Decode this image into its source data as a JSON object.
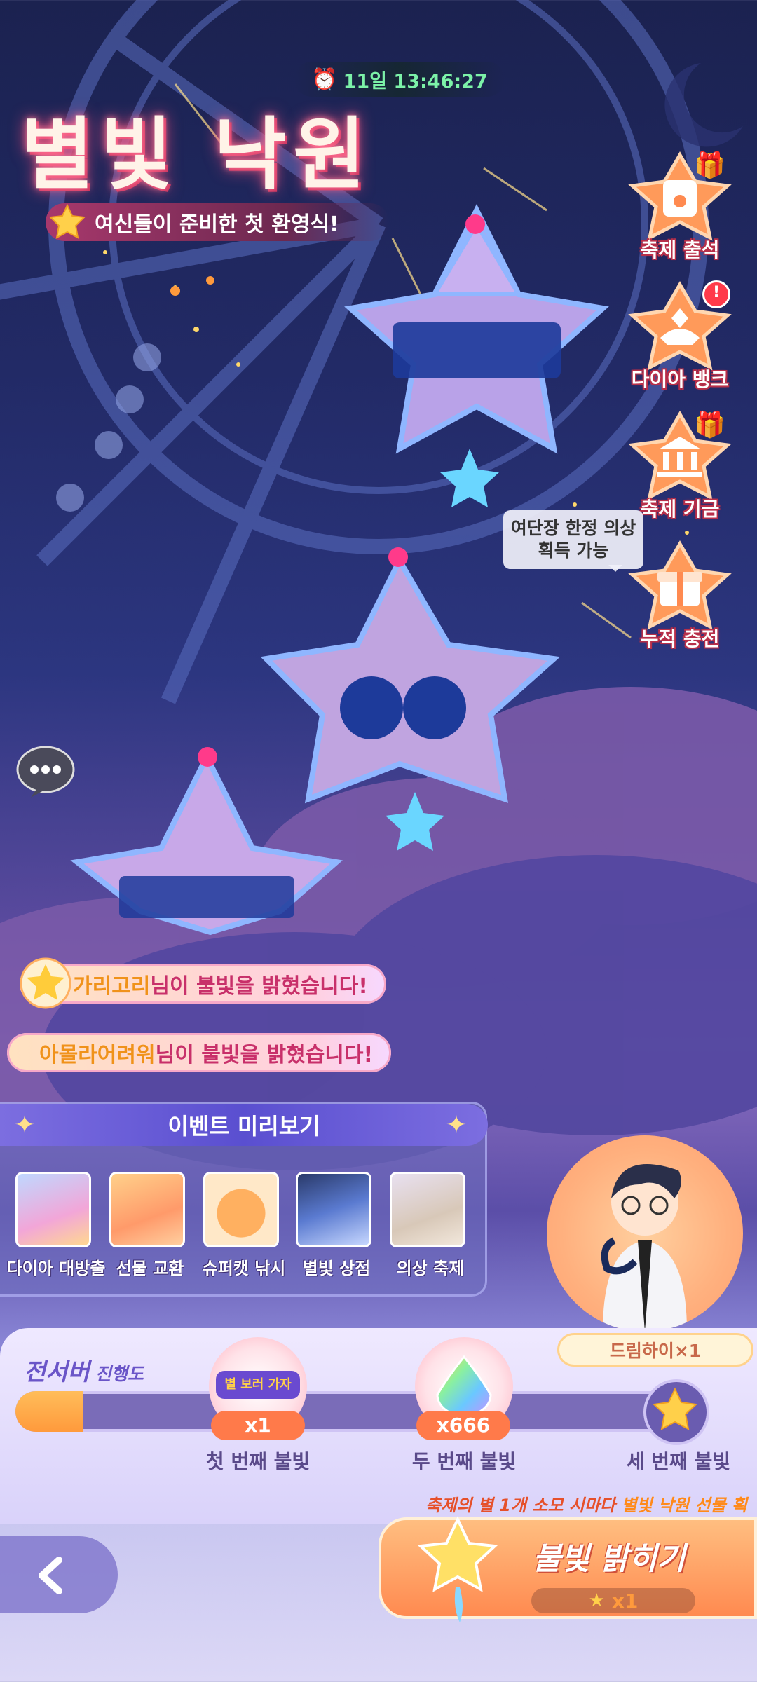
{
  "timer": {
    "text": "11일 13:46:27"
  },
  "event": {
    "title": "별빛 낙원",
    "subtitle": "여신들이 준비한 첫 환영식!"
  },
  "side_buttons": [
    {
      "label": "축제 출석",
      "icon": "paw-bag-icon",
      "badge": "gift"
    },
    {
      "label": "다이아 뱅크",
      "icon": "hand-diamond-icon",
      "badge": "!"
    },
    {
      "label": "축제 기금",
      "icon": "bank-icon",
      "badge": "gift"
    },
    {
      "label": "누적 충전",
      "icon": "gift-box-icon",
      "badge": ""
    }
  ],
  "tooltip": {
    "line1": "여단장 한정 의상",
    "line2": "획득 가능"
  },
  "notices": [
    {
      "name": "가리고리",
      "text": "님이 불빛을 밝혔습니다!"
    },
    {
      "name": "아몰라어려워",
      "text": "님이 불빛을 밝혔습니다!"
    }
  ],
  "preview": {
    "title": "이벤트 미리보기",
    "items": [
      {
        "label": "다이아 대방출"
      },
      {
        "label": "선물 교환"
      },
      {
        "label": "슈퍼캣 낚시"
      },
      {
        "label": "별빛 상점"
      },
      {
        "label": "의상 축제"
      }
    ]
  },
  "reward_badge": "드림하이×1",
  "progress": {
    "title": "전서버",
    "subtitle": "진행도",
    "fill": 0.1,
    "milestones": [
      {
        "label": "첫 번째 불빛",
        "count": "x1",
        "icon_text": "별 보러 가자"
      },
      {
        "label": "두 번째 불빛",
        "count": "x666"
      },
      {
        "label": "세 번째 불빛"
      }
    ]
  },
  "reward_note": {
    "prefix": "축제의 별 1개 소모 시마다 ",
    "highlight": "별빛 낙원 선물 획득"
  },
  "action": {
    "label": "불빛 밝히기",
    "cost": "x1"
  },
  "colors": {
    "accent": "#ff8a50",
    "timer": "#7cf2a8",
    "bar": "#ff9a3c"
  }
}
